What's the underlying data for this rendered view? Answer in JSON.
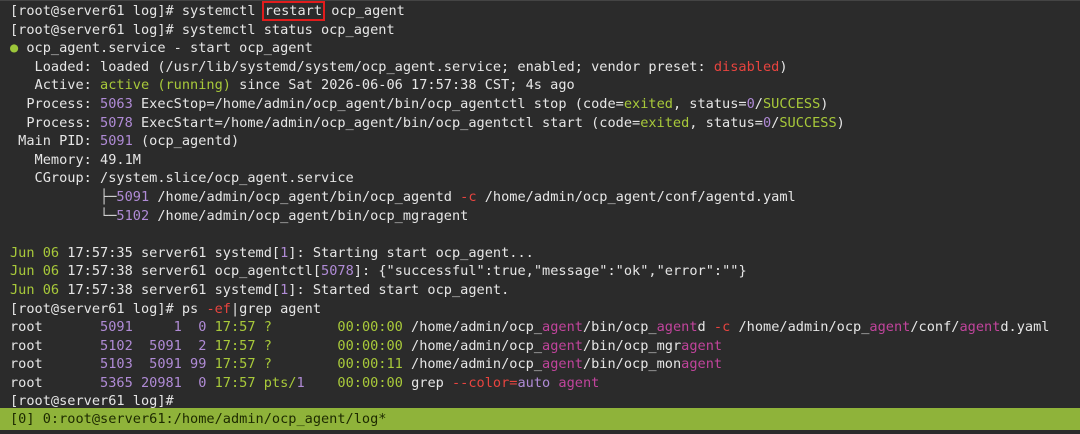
{
  "prompt": "[root@server61 log]#",
  "cmd1_pre": " systemctl ",
  "cmd1_highlight": "restart",
  "cmd1_post": " ocp_agent",
  "cmd2": " systemctl status ocp_agent",
  "svc_dot": "●",
  "svc_title": " ocp_agent.service - start ocp_agent",
  "loaded_label": "   Loaded:",
  "loaded_text": " loaded (/usr/lib/systemd/system/ocp_agent.service; enabled; vendor preset: ",
  "loaded_disabled": "disabled",
  "loaded_end": ")",
  "active_label": "   Active:",
  "active_state": " active (running)",
  "active_since": " since Sat 2026-06-06 17:57:38 CST; 4s ago",
  "proc1_label": "  Process:",
  "proc1_pid": " 5063",
  "proc1_cmd": " ExecStop=/home/admin/ocp_agent/bin/ocp_agentctl stop (code=",
  "proc1_exited": "exited",
  "proc1_mid": ", status=",
  "proc1_zero": "0",
  "proc1_slash": "/",
  "proc1_success": "SUCCESS",
  "proc1_end": ")",
  "proc2_label": "  Process:",
  "proc2_pid": " 5078",
  "proc2_cmd": " ExecStart=/home/admin/ocp_agent/bin/ocp_agentctl start (code=",
  "proc2_exited": "exited",
  "proc2_mid": ", status=",
  "proc2_zero": "0",
  "proc2_slash": "/",
  "proc2_success": "SUCCESS",
  "proc2_end": ")",
  "mainpid_label": " Main PID:",
  "mainpid_value": " 5091",
  "mainpid_name": " (ocp_agentd)",
  "memory_label": "   Memory:",
  "memory_value": " 49.1M",
  "cgroup_label": "   CGroup:",
  "cgroup_value": " /system.slice/ocp_agent.service",
  "tree1_prefix": "           ├─",
  "tree1_pid": "5091",
  "tree1_cmd": " /home/admin/ocp_agent/bin/ocp_agentd ",
  "tree1_flag": "-c",
  "tree1_path": " /home/admin/ocp_agent/conf/agentd.yaml",
  "tree2_prefix": "           └─",
  "tree2_pid": "5102",
  "tree2_cmd": " /home/admin/ocp_agent/bin/ocp_mgragent",
  "log1_date": "Jun 06",
  "log1_time": " 17:57:35",
  "log1_host": " server61 systemd",
  "log1_lb": "[",
  "log1_num": "1",
  "log1_rb": "]",
  "log1_msg": ": Starting start ocp_agent...",
  "log2_date": "Jun 06",
  "log2_time": " 17:57:38",
  "log2_host": " server61 ocp_agentctl",
  "log2_lb": "[",
  "log2_num": "5078",
  "log2_rb": "]",
  "log2_msg": ": {\"successful\":true,\"message\":\"ok\",\"error\":\"\"}",
  "log3_date": "Jun 06",
  "log3_time": " 17:57:38",
  "log3_host": " server61 systemd",
  "log3_lb": "[",
  "log3_num": "1",
  "log3_rb": "]",
  "log3_msg": ": Started start ocp_agent.",
  "cmd3_pre": " ps ",
  "cmd3_flag": "-ef",
  "cmd3_post": "|grep agent",
  "ps_rows": [
    {
      "user": "root      ",
      "pid": " 5091",
      "ppid": "     1",
      "c": "  0",
      "stime": " 17:57",
      "tty": " ?        ",
      "time": "00:00:00",
      "cmd_a": " /home/admin/ocp_",
      "cmd_b": "agent",
      "cmd_c": "/bin/ocp_",
      "cmd_d": "agent",
      "cmd_e": "d ",
      "cmd_f": "-c",
      "cmd_g": " /home/admin/ocp_",
      "cmd_h": "agent",
      "cmd_i": "/conf/",
      "cmd_j": "agent",
      "cmd_k": "d.yaml"
    },
    {
      "user": "root      ",
      "pid": " 5102",
      "ppid": "  5091",
      "c": "  2",
      "stime": " 17:57",
      "tty": " ?        ",
      "time": "00:00:00",
      "cmd_a": " /home/admin/ocp_",
      "cmd_b": "agent",
      "cmd_c": "/bin/ocp_mgr",
      "cmd_d": "agent"
    },
    {
      "user": "root      ",
      "pid": " 5103",
      "ppid": "  5091",
      "c": " 99",
      "stime": " 17:57",
      "tty": " ?        ",
      "time": "00:00:11",
      "cmd_a": " /home/admin/ocp_",
      "cmd_b": "agent",
      "cmd_c": "/bin/ocp_mon",
      "cmd_d": "agent"
    },
    {
      "user": "root      ",
      "pid": " 5365",
      "ppid": " 20981",
      "c": "  0",
      "stime": " 17:57",
      "tty": " pts/",
      "tty_num": "1",
      "tty_pad": "    ",
      "time": "00:00:00",
      "cmd_a": " grep ",
      "cmd_b": "--color=",
      "cmd_c": "auto",
      "cmd_d": " agent"
    }
  ],
  "final_prompt": "[root@server61 log]#",
  "status_bar": "[0] 0:root@server61:/home/admin/ocp_agent/log*"
}
